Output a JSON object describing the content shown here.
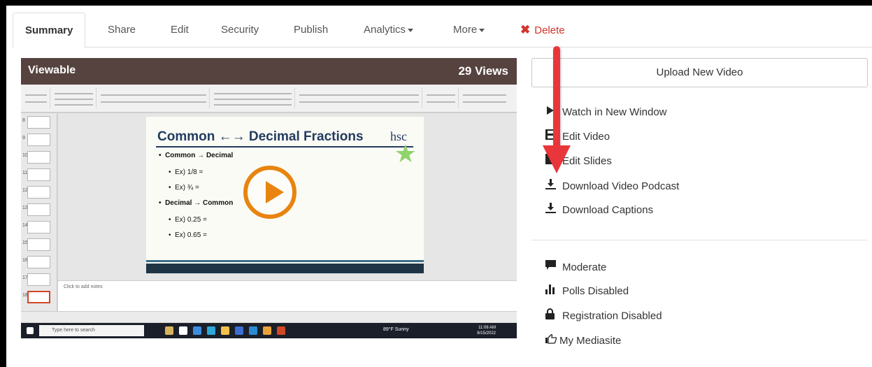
{
  "tabs": [
    {
      "label": "Summary",
      "active": true
    },
    {
      "label": "Share"
    },
    {
      "label": "Edit"
    },
    {
      "label": "Security"
    },
    {
      "label": "Publish"
    },
    {
      "label": "Analytics"
    },
    {
      "label": "More"
    },
    {
      "label": "Delete"
    }
  ],
  "video": {
    "status": "Viewable",
    "views": "29 Views",
    "slide_title": "Common ←→ Decimal Fractions",
    "slide_logo": "hsc",
    "bullets": [
      "Common → Decimal",
      "Ex) 1/8 =",
      "Ex) ¾ =",
      "Decimal → Common",
      "Ex) 0.25 =",
      "Ex) 0.65 ="
    ],
    "notes_placeholder": "Click to add notes",
    "taskbar_search": "Type here to search",
    "weather": "89°F Sunny",
    "clock_time": "11:08 AM",
    "clock_date": "8/15/2022"
  },
  "panel": {
    "upload_label": "Upload New Video",
    "actions": [
      {
        "label": "Watch in New Window",
        "icon": "play-icon"
      },
      {
        "label": "Edit Video",
        "icon": "film-icon"
      },
      {
        "label": "Edit Slides",
        "icon": "slides-icon"
      },
      {
        "label": "Download Video Podcast",
        "icon": "download-icon"
      },
      {
        "label": "Download Captions",
        "icon": "download-icon"
      }
    ],
    "settings": [
      {
        "label": "Moderate",
        "icon": "comment-icon"
      },
      {
        "label": "Polls Disabled",
        "icon": "bar-chart-icon"
      },
      {
        "label": "Registration Disabled",
        "icon": "lock-icon"
      },
      {
        "label": "My Mediasite",
        "icon": "pointing-hand-icon"
      }
    ]
  },
  "colors": {
    "delete": "#d0352c",
    "play": "#e8840f",
    "arrow": "#e8363a",
    "slide_title": "#233b5f"
  }
}
